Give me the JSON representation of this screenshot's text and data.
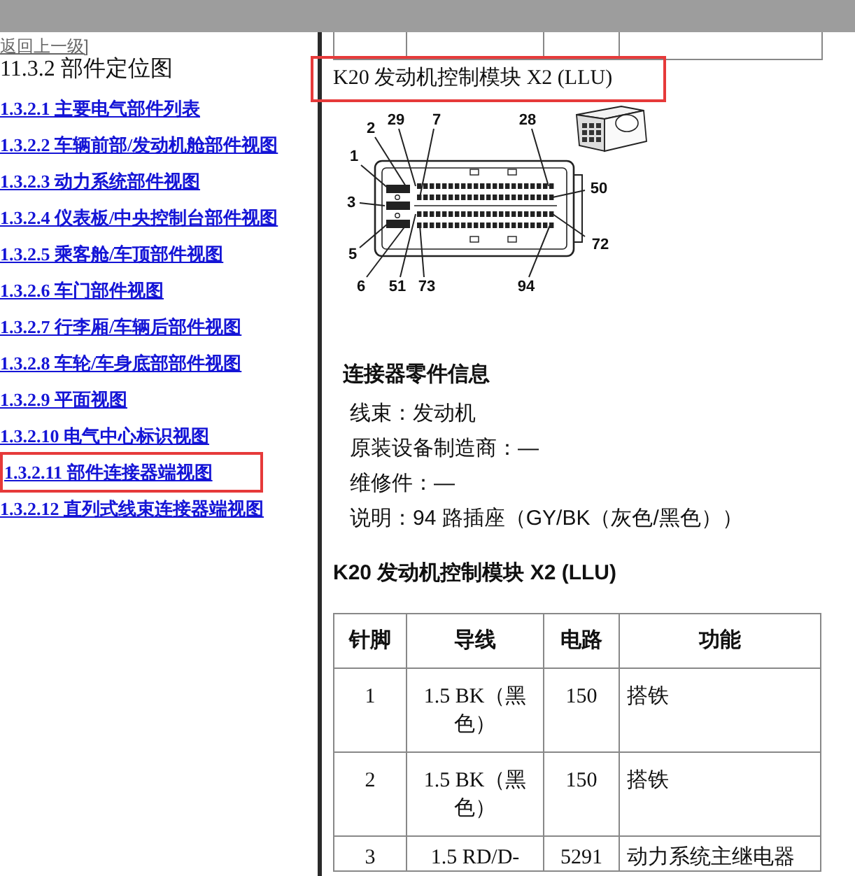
{
  "sidebar": {
    "back_link": "返回上一级]",
    "title": "11.3.2 部件定位图",
    "items": [
      {
        "label": "1.3.2.1 主要电气部件列表",
        "highlighted": false
      },
      {
        "label": "1.3.2.2 车辆前部/发动机舱部件视图",
        "highlighted": false
      },
      {
        "label": "1.3.2.3 动力系统部件视图",
        "highlighted": false
      },
      {
        "label": "1.3.2.4 仪表板/中央控制台部件视图",
        "highlighted": false
      },
      {
        "label": "1.3.2.5 乘客舱/车顶部件视图",
        "highlighted": false
      },
      {
        "label": "1.3.2.6 车门部件视图",
        "highlighted": false
      },
      {
        "label": "1.3.2.7 行李厢/车辆后部件视图",
        "highlighted": false
      },
      {
        "label": "1.3.2.8 车轮/车身底部部件视图",
        "highlighted": false
      },
      {
        "label": "1.3.2.9 平面视图",
        "highlighted": false
      },
      {
        "label": "1.3.2.10 电气中心标识视图",
        "highlighted": false
      },
      {
        "label": "1.3.2.11 部件连接器端视图",
        "highlighted": true
      },
      {
        "label": "1.3.2.12 直列式线束连接器端视图",
        "highlighted": false
      }
    ]
  },
  "content": {
    "connector_title": {
      "text": "K20 发动机控制模块 X2 (LLU)",
      "highlighted": true
    },
    "connector_diagram": {
      "pin_labels": [
        "29",
        "7",
        "28",
        "2",
        "1",
        "50",
        "3",
        "72",
        "5",
        "6",
        "51",
        "73",
        "94"
      ]
    },
    "connector_info": {
      "heading": "连接器零件信息",
      "lines": [
        "线束：发动机",
        "原装设备制造商：—",
        "维修件：—",
        "说明：94 路插座（GY/BK（灰色/黑色））"
      ]
    },
    "table_title": "K20 发动机控制模块 X2 (LLU)",
    "table": {
      "columns": [
        "针脚",
        "导线",
        "电路",
        "功能"
      ],
      "rows": [
        [
          "1",
          "1.5 BK（黑色）",
          "150",
          "搭铁"
        ],
        [
          "2",
          "1.5 BK（黑色）",
          "150",
          "搭铁"
        ],
        [
          "3",
          "1.5 RD/D-",
          "5291",
          "动力系统主继电器"
        ]
      ]
    }
  }
}
